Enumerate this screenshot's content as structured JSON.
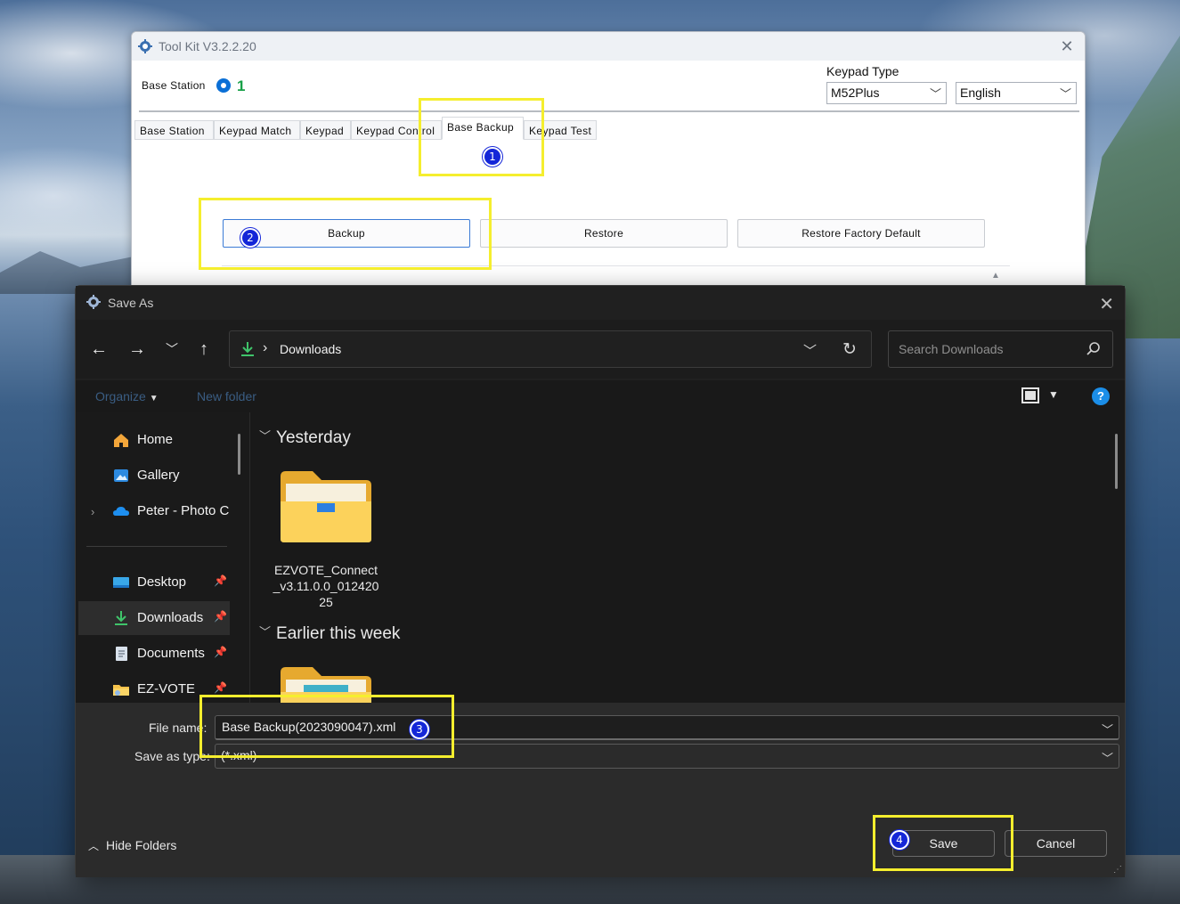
{
  "toolkit": {
    "title": "Tool Kit  V3.2.2.20",
    "base_station_label": "Base Station",
    "base_station_number": "1",
    "keypad_type_label": "Keypad Type",
    "keypad_model": "M52Plus",
    "language": "English",
    "tabs": [
      {
        "label": "Base Station",
        "active": false
      },
      {
        "label": "Keypad Match",
        "active": false
      },
      {
        "label": "Keypad",
        "active": false
      },
      {
        "label": "Keypad Control",
        "active": false
      },
      {
        "label": "Base Backup",
        "active": true
      },
      {
        "label": "Keypad Test",
        "active": false
      }
    ],
    "buttons": {
      "backup": "Backup",
      "restore": "Restore",
      "restore_factory": "Restore Factory Default"
    }
  },
  "save_dialog": {
    "title": "Save As",
    "address": "Downloads",
    "search_placeholder": "Search Downloads",
    "organize_label": "Organize",
    "new_folder_label": "New folder",
    "sidebar": [
      {
        "label": "Home",
        "icon": "home-icon",
        "pinned": false,
        "selected": false
      },
      {
        "label": "Gallery",
        "icon": "gallery-icon",
        "pinned": false,
        "selected": false
      },
      {
        "label": "Peter - Photo C",
        "icon": "onedrive-cloud-icon",
        "pinned": false,
        "selected": false
      },
      {
        "label": "Desktop",
        "icon": "desktop-icon",
        "pinned": true,
        "selected": false
      },
      {
        "label": "Downloads",
        "icon": "download-icon",
        "pinned": true,
        "selected": true
      },
      {
        "label": "Documents",
        "icon": "documents-icon",
        "pinned": true,
        "selected": false
      },
      {
        "label": "EZ-VOTE",
        "icon": "folder-icon",
        "pinned": true,
        "selected": false
      }
    ],
    "groups": [
      {
        "header": "Yesterday",
        "items": [
          {
            "name": "EZVOTE_Connect_v3.11.0.0_01242025"
          }
        ]
      },
      {
        "header": "Earlier this week",
        "items": []
      }
    ],
    "file_name_label": "File name:",
    "file_name_value": "Base Backup(2023090047).xml",
    "save_as_type_label": "Save as type:",
    "save_as_type_value": "(*.xml)",
    "hide_folders_label": "Hide Folders",
    "save_label": "Save",
    "cancel_label": "Cancel"
  },
  "annotations": {
    "highlight_color": "#f5ee2e",
    "badge_color": "#1426d8",
    "steps": [
      "1",
      "2",
      "3",
      "4"
    ]
  }
}
